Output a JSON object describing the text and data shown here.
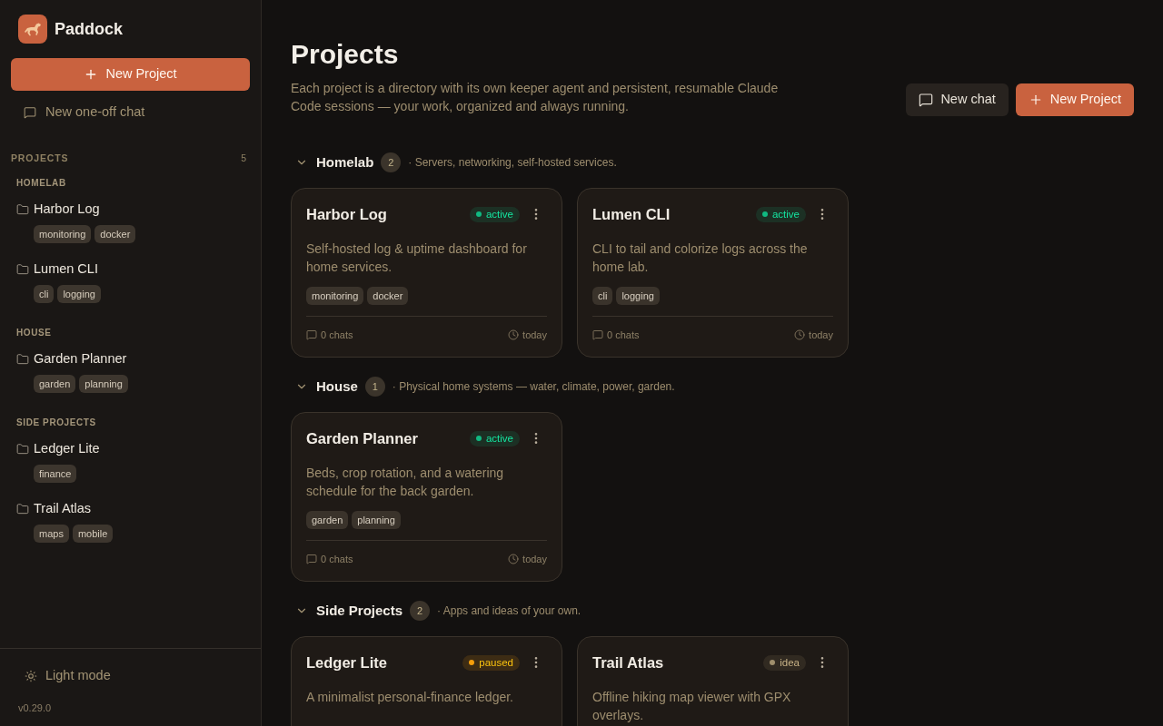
{
  "app": {
    "name": "Paddock"
  },
  "sidebar": {
    "new_project_button": "New Project",
    "new_chat_link": "New one-off chat",
    "projects_label": "PROJECTS",
    "projects_count": "5",
    "groups": [
      {
        "label": "HOMELAB",
        "projects": [
          {
            "name": "Harbor Log",
            "tags": [
              "monitoring",
              "docker"
            ]
          },
          {
            "name": "Lumen CLI",
            "tags": [
              "cli",
              "logging"
            ]
          }
        ]
      },
      {
        "label": "HOUSE",
        "projects": [
          {
            "name": "Garden Planner",
            "tags": [
              "garden",
              "planning"
            ]
          }
        ]
      },
      {
        "label": "SIDE PROJECTS",
        "projects": [
          {
            "name": "Ledger Lite",
            "tags": [
              "finance"
            ]
          },
          {
            "name": "Trail Atlas",
            "tags": [
              "maps",
              "mobile"
            ]
          }
        ]
      }
    ],
    "theme_toggle": "Light mode",
    "version": "v0.29.0"
  },
  "header": {
    "title": "Projects",
    "description": "Each project is a directory with its own keeper agent and persistent, resumable Claude Code sessions — your work, organized and always running.",
    "buttons": [
      {
        "label": "New chat",
        "kind": "secondary"
      },
      {
        "label": "New Project",
        "kind": "primary"
      }
    ]
  },
  "groups": [
    {
      "title": "Homelab",
      "count": "2",
      "description": "· Servers, networking, self-hosted services.",
      "expanded": true,
      "cards": [
        {
          "title": "Harbor Log",
          "status": {
            "label": "active",
            "color": "#10b981"
          },
          "description": "Self-hosted log & uptime dashboard for home services.",
          "tags": [
            "monitoring",
            "docker"
          ],
          "chats": "0 chats",
          "updated": "today"
        },
        {
          "title": "Lumen CLI",
          "status": {
            "label": "active",
            "color": "#10b981"
          },
          "description": "CLI to tail and colorize logs across the home lab.",
          "tags": [
            "cli",
            "logging"
          ],
          "chats": "0 chats",
          "updated": "today"
        }
      ]
    },
    {
      "title": "House",
      "count": "1",
      "description": "· Physical home systems — water, climate, power, garden.",
      "expanded": true,
      "cards": [
        {
          "title": "Garden Planner",
          "status": {
            "label": "active",
            "color": "#10b981"
          },
          "description": "Beds, crop rotation, and a watering schedule for the back garden.",
          "tags": [
            "garden",
            "planning"
          ],
          "chats": "0 chats",
          "updated": "today"
        }
      ]
    },
    {
      "title": "Side Projects",
      "count": "2",
      "description": "· Apps and ideas of your own.",
      "expanded": true,
      "cards": [
        {
          "title": "Ledger Lite",
          "status": {
            "label": "paused",
            "color": "#f59e0b"
          },
          "description": "A minimalist personal-finance ledger."
        },
        {
          "title": "Trail Atlas",
          "status": {
            "label": "idea",
            "color": "#a08f6c"
          },
          "description": "Offline hiking map viewer with GPX overlays."
        }
      ]
    }
  ]
}
